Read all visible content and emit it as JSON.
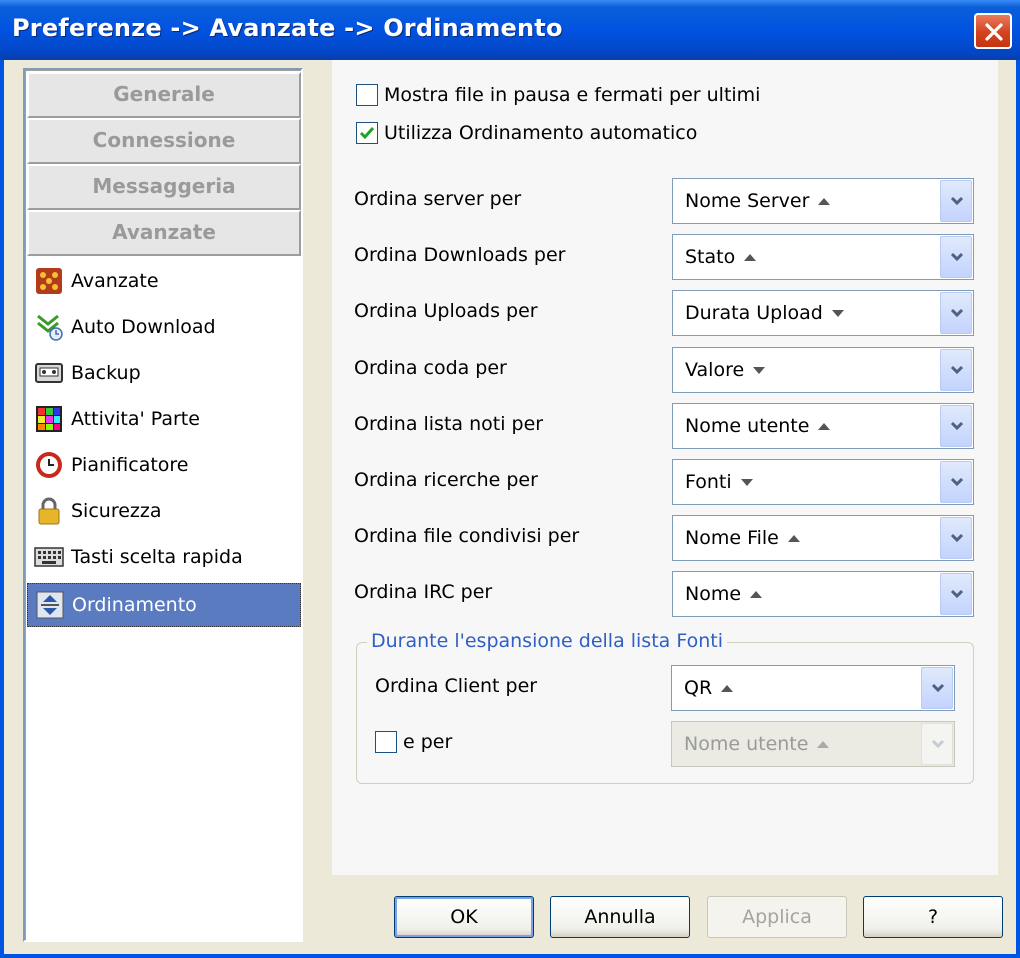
{
  "window": {
    "title": "Preferenze -> Avanzate -> Ordinamento"
  },
  "nav": {
    "groups": [
      "Generale",
      "Connessione",
      "Messaggeria",
      "Avanzate"
    ],
    "items": [
      {
        "label": "Avanzate",
        "icon": "advanced-icon"
      },
      {
        "label": "Auto Download",
        "icon": "auto-download-icon"
      },
      {
        "label": "Backup",
        "icon": "backup-icon"
      },
      {
        "label": "Attivita' Parte",
        "icon": "part-activity-icon"
      },
      {
        "label": "Pianificatore",
        "icon": "clock-icon"
      },
      {
        "label": "Sicurezza",
        "icon": "lock-icon"
      },
      {
        "label": "Tasti scelta rapida",
        "icon": "keyboard-icon"
      },
      {
        "label": "Ordinamento",
        "icon": "sort-icon",
        "selected": true
      }
    ]
  },
  "options": {
    "show_paused_last": {
      "label": "Mostra file in pausa e fermati per ultimi",
      "checked": false
    },
    "auto_sort": {
      "label": "Utilizza Ordinamento automatico",
      "checked": true
    }
  },
  "sort_rows": [
    {
      "label": "Ordina server per",
      "value": "Nome Server",
      "direction": "asc"
    },
    {
      "label": "Ordina Downloads per",
      "value": "Stato",
      "direction": "asc"
    },
    {
      "label": "Ordina Uploads per",
      "value": "Durata Upload",
      "direction": "desc"
    },
    {
      "label": "Ordina coda per",
      "value": "Valore",
      "direction": "desc"
    },
    {
      "label": "Ordina lista noti per",
      "value": "Nome utente",
      "direction": "asc"
    },
    {
      "label": "Ordina ricerche per",
      "value": "Fonti",
      "direction": "desc"
    },
    {
      "label": "Ordina file condivisi per",
      "value": "Nome File",
      "direction": "asc"
    },
    {
      "label": "Ordina IRC per",
      "value": "Nome",
      "direction": "asc"
    }
  ],
  "sources_group": {
    "legend": "Durante l'espansione della lista Fonti",
    "client_label": "Ordina Client per",
    "client_value": "QR",
    "client_direction": "asc",
    "and_label": "e per",
    "and_checked": false,
    "and_value": "Nome utente",
    "and_direction": "asc"
  },
  "buttons": {
    "ok": "OK",
    "cancel": "Annulla",
    "apply": "Applica",
    "help": "?"
  },
  "colors": {
    "titlebar": "#0153e1",
    "selected": "#5b7bc0",
    "legend": "#2f5fc4"
  }
}
